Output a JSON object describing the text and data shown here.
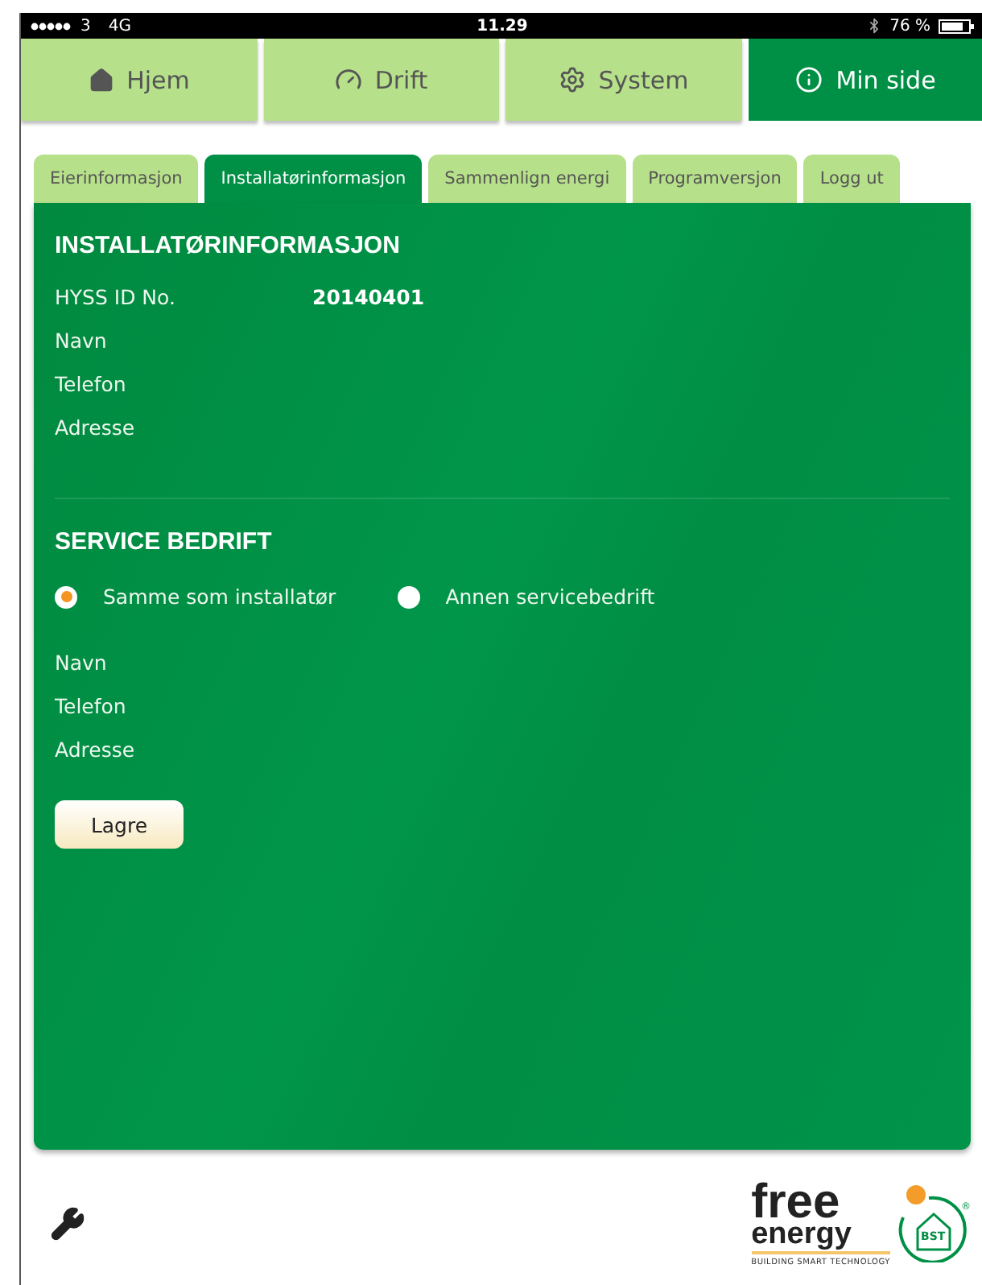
{
  "status_bar": {
    "carrier": "3",
    "network": "4G",
    "time": "11.29",
    "battery": "76 %"
  },
  "nav": [
    {
      "label": "Hjem",
      "kind": "home",
      "selected": false
    },
    {
      "label": "Drift",
      "kind": "gauge",
      "selected": false
    },
    {
      "label": "System",
      "kind": "gear",
      "selected": false
    },
    {
      "label": "Min side",
      "kind": "info",
      "selected": true
    }
  ],
  "tabs": [
    {
      "label": "Eierinformasjon",
      "selected": false
    },
    {
      "label": "Installatørinformasjon",
      "selected": true
    },
    {
      "label": "Sammenlign energi",
      "selected": false
    },
    {
      "label": "Programversjon",
      "selected": false
    },
    {
      "label": "Logg ut",
      "selected": false
    }
  ],
  "installer": {
    "title": "INSTALLATØRINFORMASJON",
    "fields": [
      {
        "label": "HYSS ID No.",
        "value": "20140401"
      },
      {
        "label": "Navn"
      },
      {
        "label": "Telefon"
      },
      {
        "label": "Adresse"
      }
    ]
  },
  "service": {
    "title": "SERVICE BEDRIFT",
    "options": [
      {
        "label": "Samme som installatør",
        "selected": true
      },
      {
        "label": "Annen servicebedrift",
        "selected": false
      }
    ],
    "fields": [
      {
        "label": "Navn"
      },
      {
        "label": "Telefon"
      },
      {
        "label": "Adresse"
      }
    ],
    "save_button": "Lagre"
  },
  "logo": {
    "word_1": "free",
    "word_2": "energy",
    "mark": "BST",
    "registered": "®",
    "tagline": "BUILDING SMART TECHNOLOGY"
  }
}
